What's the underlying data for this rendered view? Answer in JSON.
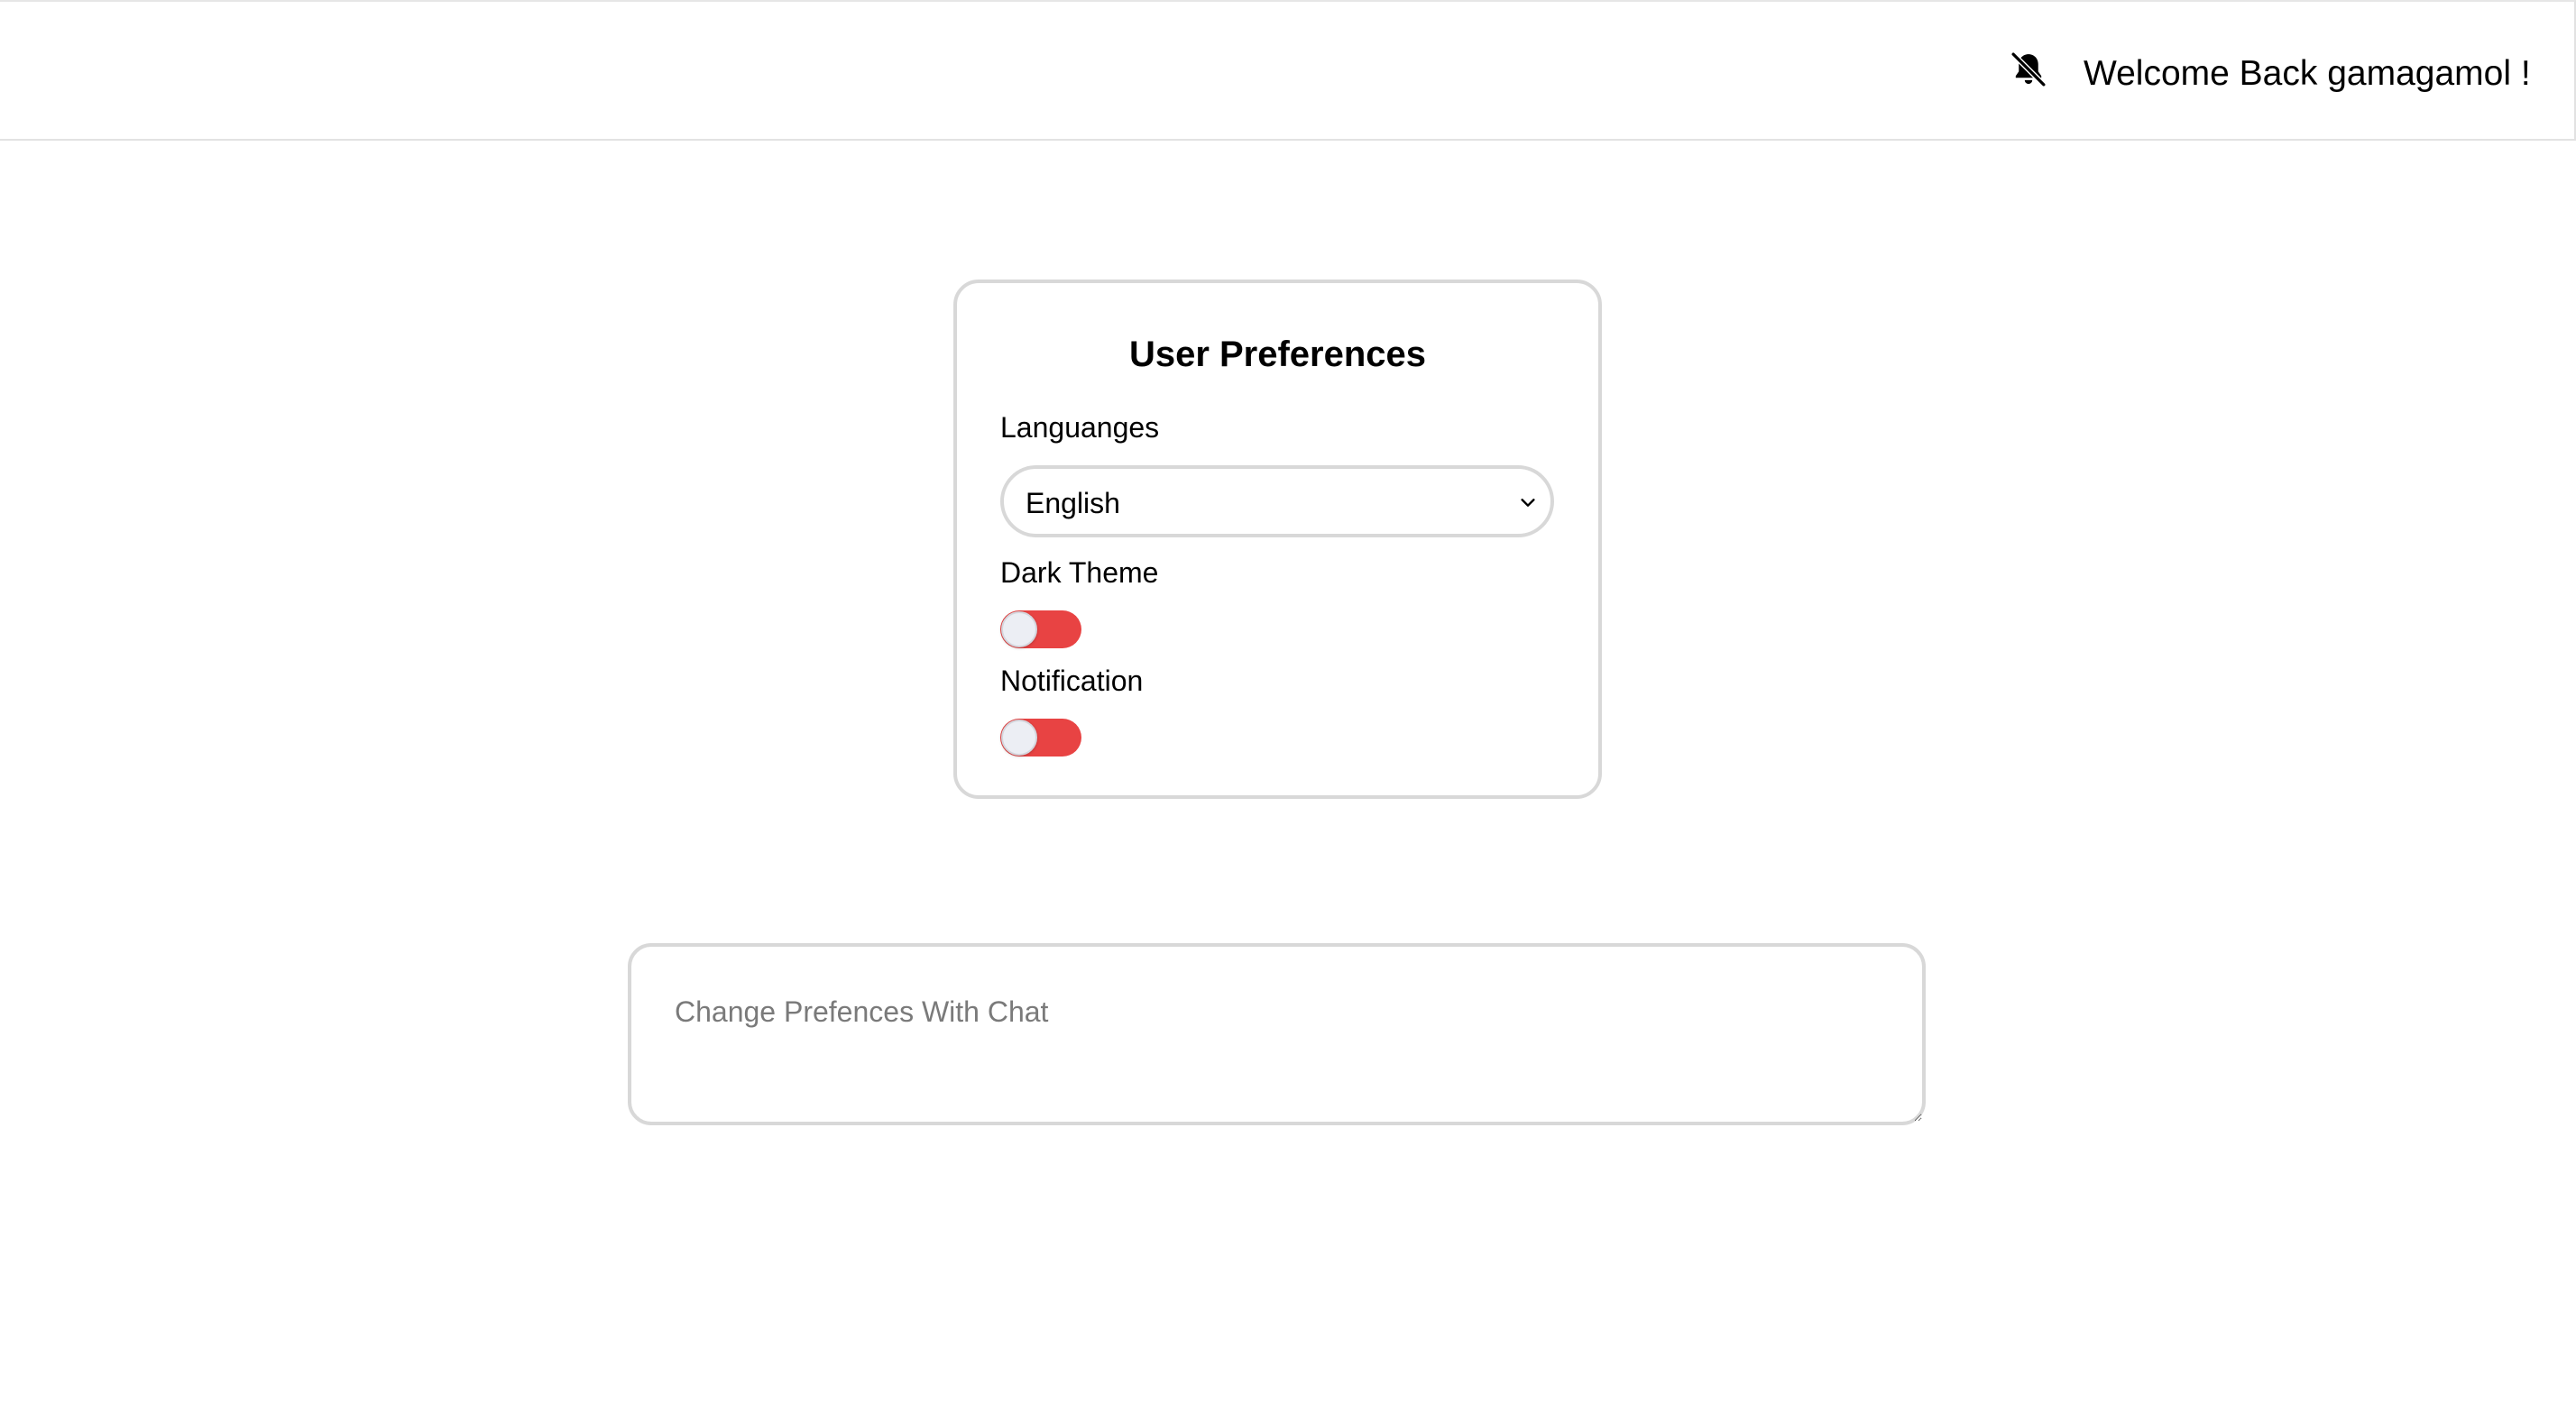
{
  "header": {
    "notification_icon": "bell-off-icon",
    "welcome_text": "Welcome Back gamagamol !"
  },
  "preferences": {
    "title": "User Preferences",
    "language_label": "Languanges",
    "language_value": "English",
    "language_options": [
      "English"
    ],
    "dark_theme_label": "Dark Theme",
    "dark_theme_enabled": false,
    "notification_label": "Notification",
    "notification_enabled": false
  },
  "chat": {
    "placeholder": "Change Prefences With Chat",
    "value": ""
  },
  "colors": {
    "toggle_track": "#e84343",
    "toggle_knob": "#eceef4",
    "border": "#d8d8d8",
    "placeholder": "#7a7a7a"
  }
}
